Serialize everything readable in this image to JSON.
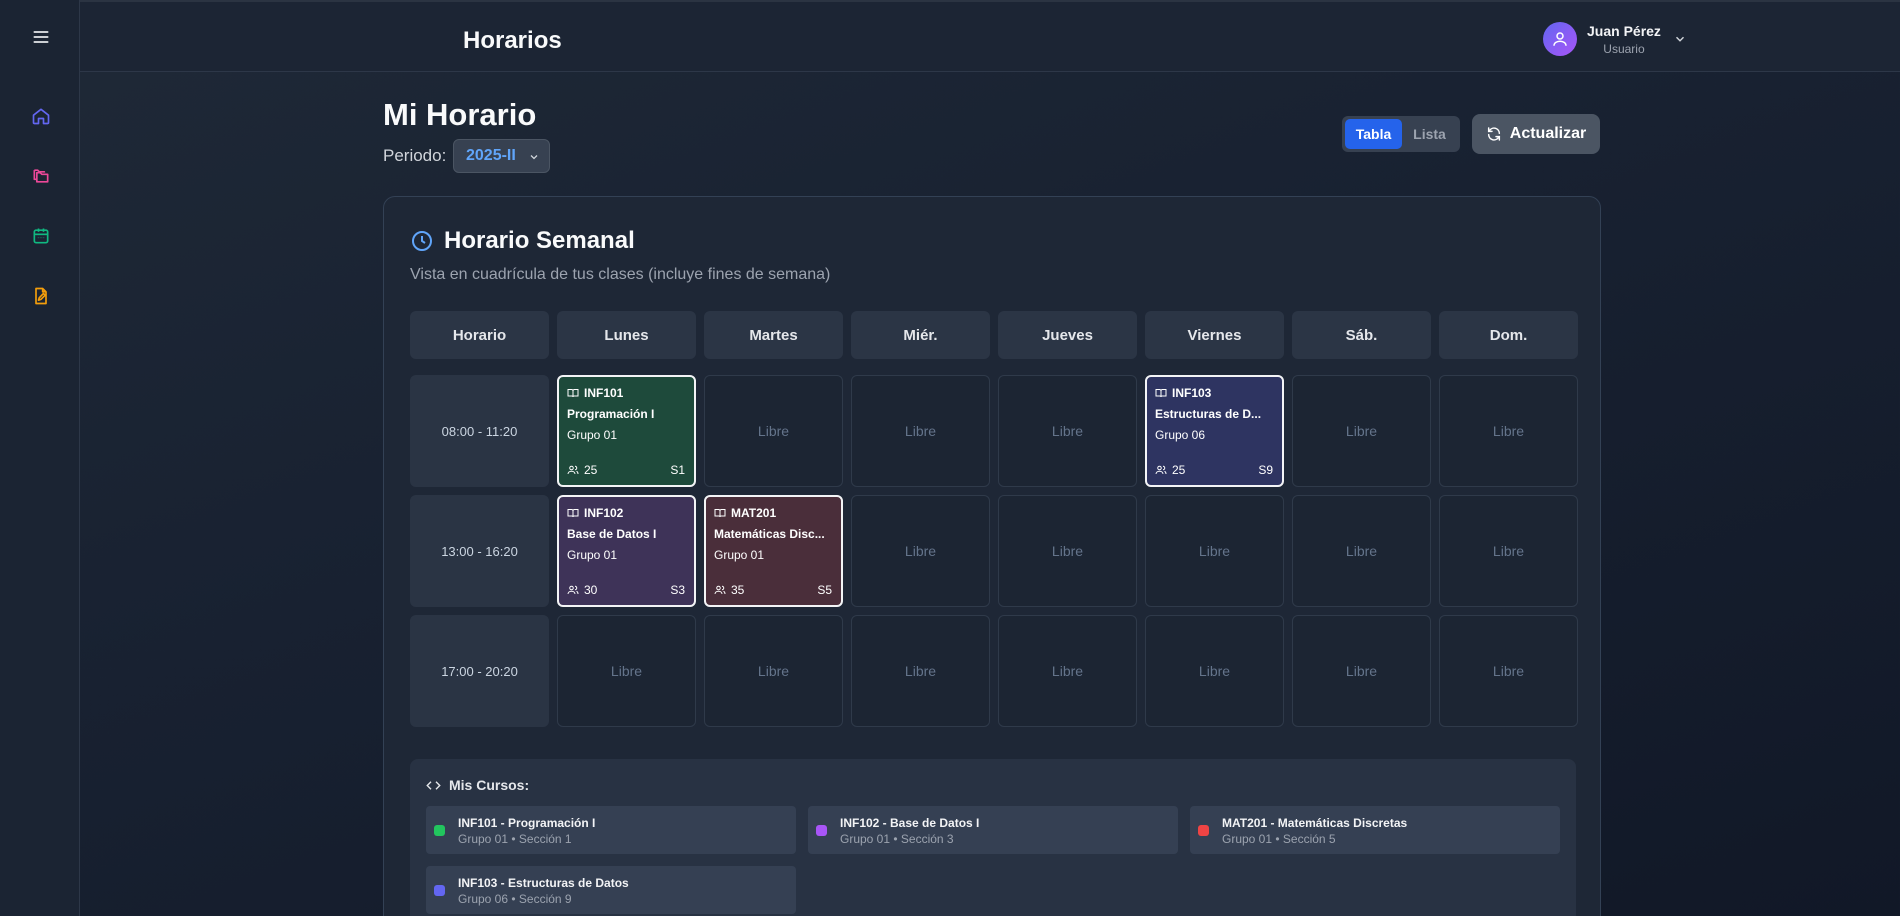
{
  "header": {
    "title": "Horarios"
  },
  "user": {
    "name": "Juan Pérez",
    "role": "Usuario"
  },
  "page": {
    "title": "Mi Horario",
    "periodo_label": "Periodo:",
    "periodo_value": "2025-II",
    "view_toggle": {
      "tabla": "Tabla",
      "lista": "Lista"
    },
    "refresh_label": "Actualizar"
  },
  "schedule": {
    "title": "Horario Semanal",
    "subtitle": "Vista en cuadrícula de tus clases (incluye fines de semana)",
    "headers": [
      "Horario",
      "Lunes",
      "Martes",
      "Miér.",
      "Jueves",
      "Viernes",
      "Sáb.",
      "Dom."
    ],
    "times": [
      "08:00 - 11:20",
      "13:00 - 16:20",
      "17:00 - 20:20"
    ],
    "free_label": "Libre",
    "classes": [
      {
        "code": "INF101",
        "name": "Programación I",
        "group": "Grupo 01",
        "students": "25",
        "section": "S1",
        "color": "#1e4a3b"
      },
      {
        "code": "INF103",
        "name": "Estructuras de D...",
        "group": "Grupo 06",
        "students": "25",
        "section": "S9",
        "color": "#2e3461"
      },
      {
        "code": "INF102",
        "name": "Base de Datos I",
        "group": "Grupo 01",
        "students": "30",
        "section": "S3",
        "color": "#3e3358"
      },
      {
        "code": "MAT201",
        "name": "Matemáticas Disc...",
        "group": "Grupo 01",
        "students": "35",
        "section": "S5",
        "color": "#4a2e3a"
      }
    ]
  },
  "courses": {
    "title": "Mis Cursos:",
    "items": [
      {
        "title": "INF101 - Programación I",
        "sub": "Grupo 01 • Sección 1",
        "color": "#22c55e"
      },
      {
        "title": "INF102 - Base de Datos I",
        "sub": "Grupo 01 • Sección 3",
        "color": "#a855f7"
      },
      {
        "title": "MAT201 - Matemáticas Discretas",
        "sub": "Grupo 01 • Sección 5",
        "color": "#ef4444"
      },
      {
        "title": "INF103 - Estructuras de Datos",
        "sub": "Grupo 06 • Sección 9",
        "color": "#6366f1"
      }
    ]
  },
  "sidebar": {
    "items": [
      {
        "icon": "home-icon",
        "color": "#6366f1"
      },
      {
        "icon": "folders-icon",
        "color": "#ec4899"
      },
      {
        "icon": "calendar-icon",
        "color": "#10b981"
      },
      {
        "icon": "file-edit-icon",
        "color": "#f59e0b"
      }
    ]
  }
}
